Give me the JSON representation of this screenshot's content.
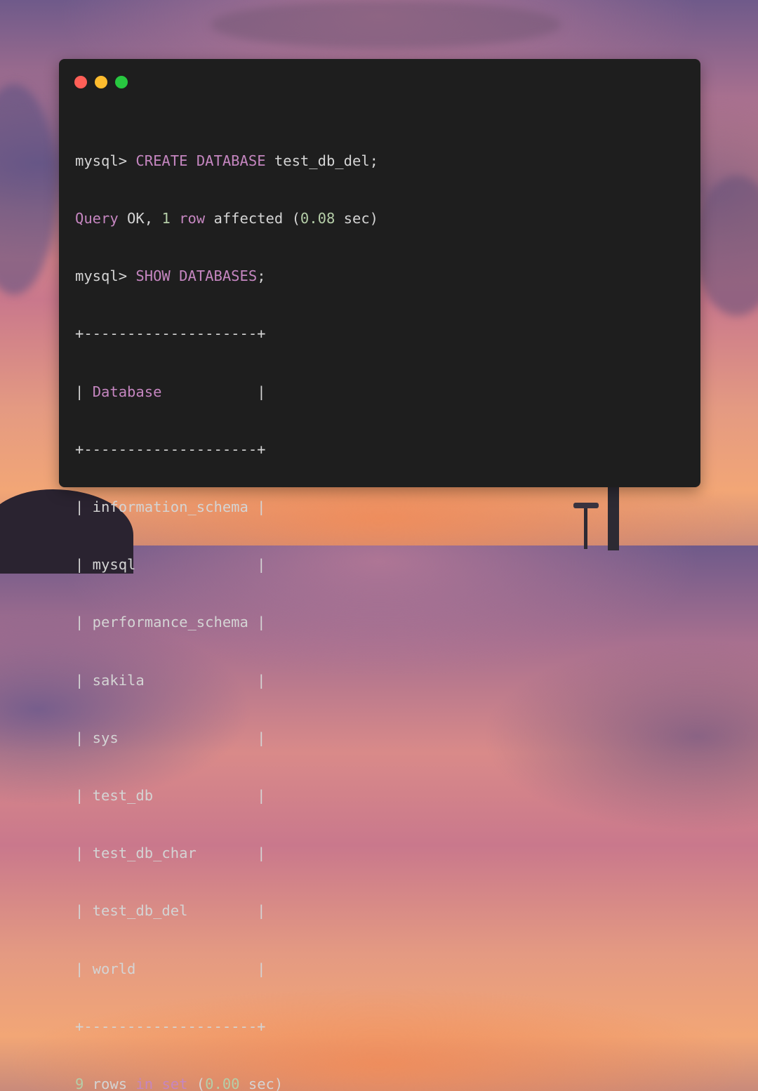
{
  "colors": {
    "text": "#d4d4d4",
    "keyword": "#c586c0",
    "number": "#b5cea8",
    "window_bg": "#1e1e1e",
    "close": "#ff5f57",
    "minimize": "#febc2e",
    "maximize": "#28c840"
  },
  "window_controls": [
    "close-icon",
    "minimize-icon",
    "maximize-icon"
  ],
  "terminal": {
    "l1": {
      "prompt": "mysql> ",
      "kw1": "CREATE",
      "sp": " ",
      "kw2": "DATABASE",
      "rest": " test_db_del;"
    },
    "l2": {
      "kw1": "Query",
      "t1": " OK, ",
      "n1": "1",
      "sp": " ",
      "kw2": "row",
      "t2": " affected (",
      "n2": "0.08",
      "t3": " sec)"
    },
    "l3": {
      "prompt": "mysql> ",
      "kw1": "SHOW",
      "sp": " ",
      "kw2": "DATABASES",
      "rest": ";"
    },
    "border": "+--------------------+",
    "header": {
      "pre": "| ",
      "label": "Database",
      "post": "           |"
    },
    "rows": [
      "| information_schema |",
      "| mysql              |",
      "| performance_schema |",
      "| sakila             |",
      "| sys                |",
      "| test_db            |",
      "| test_db_char       |",
      "| test_db_del        |",
      "| world              |"
    ],
    "footer": {
      "n1": "9",
      "t1": " rows ",
      "kw1": "in",
      "sp": " ",
      "kw2": "set",
      "t2": " (",
      "n2": "0.00",
      "t3": " sec)"
    }
  }
}
